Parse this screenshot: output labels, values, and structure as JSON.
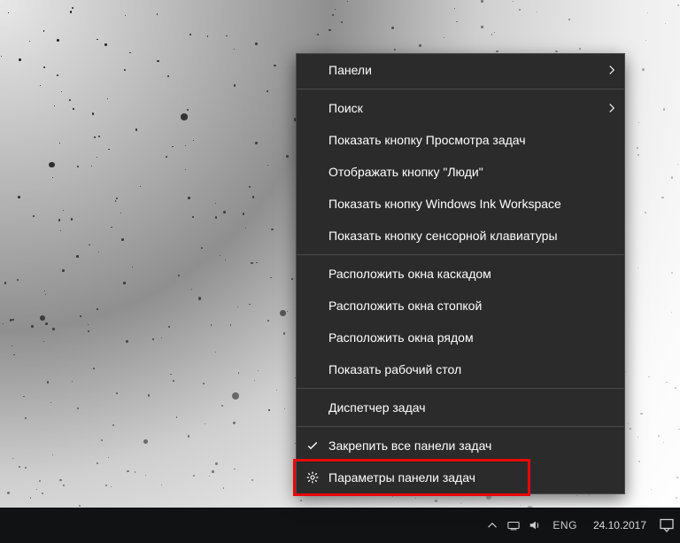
{
  "menu": {
    "items": [
      {
        "id": "toolbars",
        "label": "Панели",
        "icon": null,
        "hasSubmenu": true
      },
      {
        "id": "sep1",
        "separator": true
      },
      {
        "id": "search",
        "label": "Поиск",
        "icon": null,
        "hasSubmenu": true
      },
      {
        "id": "show-taskview",
        "label": "Показать кнопку Просмотра задач",
        "icon": null
      },
      {
        "id": "show-people",
        "label": "Отображать кнопку \"Люди\"",
        "icon": null
      },
      {
        "id": "show-ink",
        "label": "Показать кнопку Windows Ink Workspace",
        "icon": null
      },
      {
        "id": "show-touchkb",
        "label": "Показать кнопку сенсорной клавиатуры",
        "icon": null
      },
      {
        "id": "sep2",
        "separator": true
      },
      {
        "id": "cascade",
        "label": "Расположить окна каскадом",
        "icon": null
      },
      {
        "id": "stack",
        "label": "Расположить окна стопкой",
        "icon": null
      },
      {
        "id": "sidebyside",
        "label": "Расположить окна рядом",
        "icon": null
      },
      {
        "id": "show-desktop",
        "label": "Показать рабочий стол",
        "icon": null
      },
      {
        "id": "sep3",
        "separator": true
      },
      {
        "id": "taskmgr",
        "label": "Диспетчер задач",
        "icon": null
      },
      {
        "id": "sep4",
        "separator": true
      },
      {
        "id": "lock-taskbars",
        "label": "Закрепить все панели задач",
        "icon": "check"
      },
      {
        "id": "taskbar-settings",
        "label": "Параметры панели задач",
        "icon": "gear",
        "highlighted": true
      }
    ]
  },
  "tray": {
    "language": "ENG",
    "date": "24.10.2017"
  }
}
